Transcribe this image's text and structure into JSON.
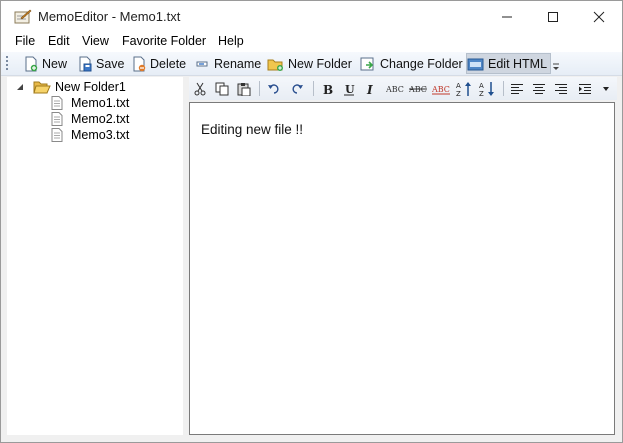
{
  "window": {
    "title": "MemoEditor - Memo1.txt"
  },
  "menu": [
    "File",
    "Edit",
    "View",
    "Favorite Folder",
    "Help"
  ],
  "toolbar": {
    "new_label": "New",
    "save_label": "Save",
    "delete_label": "Delete",
    "rename_label": "Rename",
    "new_folder_label": "New Folder",
    "change_folder_label": "Change Folder",
    "edit_html_label": "Edit HTML"
  },
  "tree": {
    "folder": "New Folder1",
    "files": [
      "Memo1.txt",
      "Memo2.txt",
      "Memo3.txt"
    ]
  },
  "format_toolbar": {
    "icons": [
      "cut-icon",
      "copy-icon",
      "paste-icon",
      "undo-icon",
      "redo-icon",
      "bold-icon",
      "underline-icon",
      "italic-icon",
      "small-caps-icon",
      "strikethrough-icon",
      "font-color-icon",
      "sort-ascending-icon",
      "sort-descending-icon",
      "align-left-icon",
      "align-center-icon",
      "align-right-icon",
      "indent-icon"
    ]
  },
  "editor": {
    "content": "Editing new file !!"
  },
  "colors": {
    "accent": "#2f6fb5",
    "folder": "#e8b949"
  }
}
